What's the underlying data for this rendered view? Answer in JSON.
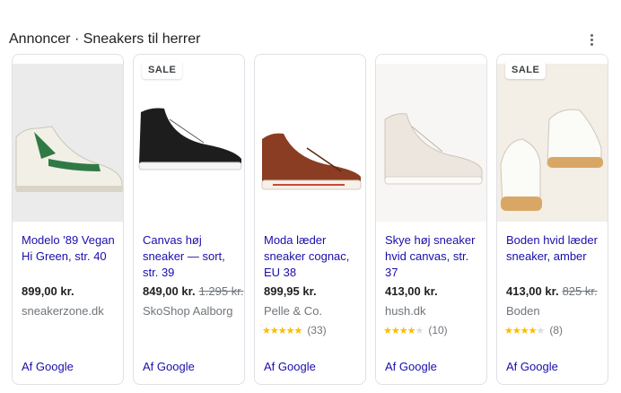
{
  "header": {
    "title": "Annoncer · Sneakers til herrer"
  },
  "colors": {
    "link": "#1a0dab",
    "star": "#fbbc04",
    "border": "#dfe1e5"
  },
  "cards": [
    {
      "title": "Modelo '89 Vegan Hi Green, str. 40",
      "price": "899,00 kr.",
      "old_price": "",
      "store": "sneakerzone.dk",
      "sale": "",
      "stars": "",
      "reviews": "",
      "source": "Af Google"
    },
    {
      "title": "Canvas høj sneaker — sort, str. 39",
      "price": "849,00 kr.",
      "old_price": "1.295 kr.",
      "store": "SkoShop Aalborg",
      "sale": "SALE",
      "stars": "",
      "reviews": "",
      "source": "Af Google"
    },
    {
      "title": "Moda læder sneaker cognac, EU 38",
      "price": "899,95 kr.",
      "old_price": "",
      "store": "Pelle & Co.",
      "sale": "",
      "stars": "★★★★★",
      "reviews": "(33)",
      "source": "Af Google"
    },
    {
      "title": "Skye høj sneaker hvid canvas, str. 37",
      "price": "413,00 kr.",
      "old_price": "",
      "store": "hush.dk",
      "sale": "",
      "stars": "★★★★",
      "reviews": "(10)",
      "source": "Af Google"
    },
    {
      "title": "Boden hvid læder sneaker, amber",
      "price": "413,00 kr.",
      "old_price": "825 kr.",
      "store": "Boden",
      "sale": "SALE",
      "stars": "★★★★",
      "reviews": "(8)",
      "source": "Af Google"
    }
  ]
}
